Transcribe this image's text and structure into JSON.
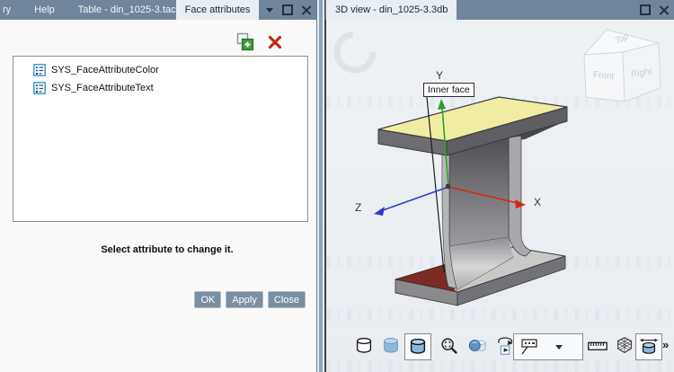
{
  "left_panel": {
    "menu": {
      "partial_item": "ry",
      "help": "Help",
      "table_window": "Table - din_1025-3.tac"
    },
    "tab": "Face attributes",
    "attribute_list": {
      "items": [
        {
          "label": "SYS_FaceAttributeColor"
        },
        {
          "label": "SYS_FaceAttributeText"
        }
      ]
    },
    "hint": "Select attribute to change it.",
    "buttons": {
      "ok": "OK",
      "apply": "Apply",
      "close": "Close"
    }
  },
  "right_panel": {
    "tab": "3D view - din_1025-3.3db",
    "axes": {
      "x": "X",
      "y": "Y",
      "z": "Z"
    },
    "face_label": "Inner face",
    "view_cube": {
      "top": "Top",
      "front": "Front",
      "right": "Right"
    },
    "toolbar": {
      "overflow": "»"
    },
    "colors": {
      "titlebar": "#70859a",
      "top_face_yellow": "#f0eda3",
      "inner_face_red": "#7b2b23",
      "axis_x": "#d42714",
      "axis_y": "#2f9e2f",
      "axis_z": "#2b3bd6"
    }
  }
}
